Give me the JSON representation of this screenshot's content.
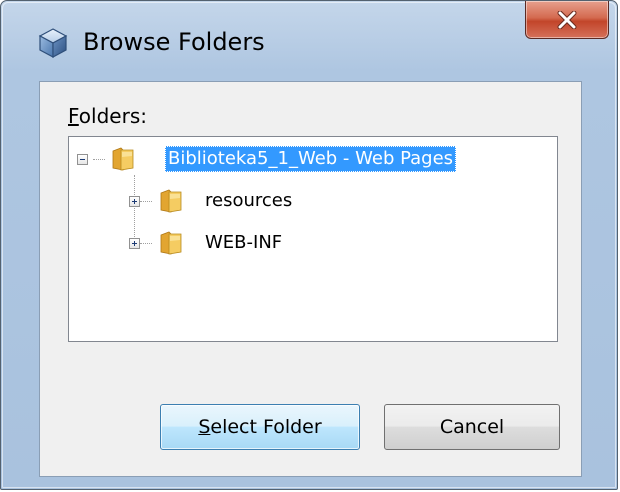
{
  "window": {
    "title": "Browse Folders",
    "title_icon": "cube-icon",
    "close_icon": "close-x-icon"
  },
  "folders_label": {
    "accel": "F",
    "rest": "olders:"
  },
  "tree": {
    "root": {
      "label": "Biblioteka5_1_Web - Web Pages",
      "expanded": true,
      "selected": true,
      "icon": "web-pages-folder-icon"
    },
    "children": [
      {
        "label": "resources",
        "expanded": false,
        "icon": "folder-icon"
      },
      {
        "label": "WEB-INF",
        "expanded": false,
        "icon": "folder-icon"
      }
    ]
  },
  "buttons": {
    "select_folder": {
      "accel": "S",
      "rest": "elect Folder"
    },
    "cancel": {
      "label": "Cancel"
    }
  },
  "colors": {
    "selection": "#3399ff",
    "default_button_border": "#3c7fb1",
    "close_button": "#c2452a"
  }
}
